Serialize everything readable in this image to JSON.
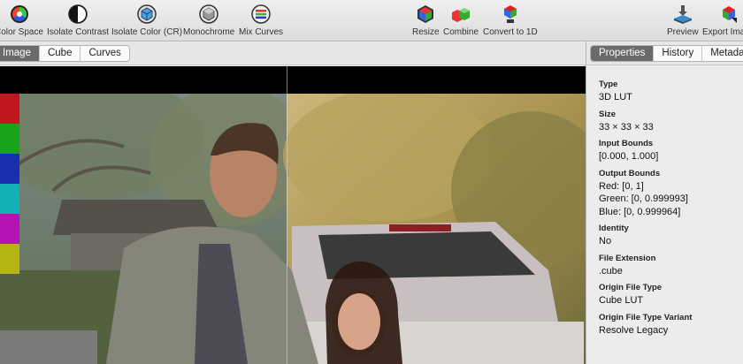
{
  "toolbar": {
    "left_tools": [
      {
        "label": "Color Space",
        "icon": "color-space-icon"
      },
      {
        "label": "Isolate Contrast",
        "icon": "isolate-contrast-icon"
      },
      {
        "label": "Isolate Color (CR)",
        "icon": "isolate-color-icon"
      },
      {
        "label": "Monochrome",
        "icon": "monochrome-icon"
      },
      {
        "label": "Mix Curves",
        "icon": "mix-curves-icon"
      }
    ],
    "center_tools": [
      {
        "label": "Resize",
        "icon": "resize-cube-icon"
      },
      {
        "label": "Combine",
        "icon": "combine-cubes-icon"
      },
      {
        "label": "Convert to 1D",
        "icon": "convert-1d-icon"
      }
    ],
    "right_tools": [
      {
        "label": "Preview",
        "icon": "preview-icon"
      },
      {
        "label": "Export Image",
        "icon": "export-image-icon"
      }
    ]
  },
  "view_tabs": [
    {
      "label": "Image",
      "active": true
    },
    {
      "label": "Cube",
      "active": false
    },
    {
      "label": "Curves",
      "active": false
    }
  ],
  "panel_tabs": [
    {
      "label": "Properties",
      "active": true
    },
    {
      "label": "History",
      "active": false
    },
    {
      "label": "Metadata",
      "active": false
    }
  ],
  "properties": {
    "type_label": "Type",
    "type_value": "3D LUT",
    "size_label": "Size",
    "size_value": "33 × 33 × 33",
    "input_bounds_label": "Input Bounds",
    "input_bounds_value": "[0.000, 1.000]",
    "output_bounds_label": "Output Bounds",
    "output_red": "Red: [0, 1]",
    "output_green": "Green: [0, 0.999993]",
    "output_blue": "Blue: [0, 0.999964]",
    "identity_label": "Identity",
    "identity_value": "No",
    "file_ext_label": "File Extension",
    "file_ext_value": ".cube",
    "origin_type_label": "Origin File Type",
    "origin_type_value": "Cube LUT",
    "origin_variant_label": "Origin File Type Variant",
    "origin_variant_value": "Resolve Legacy"
  },
  "swatch_colors": [
    "#c0161c",
    "#18a51c",
    "#1a2fb0",
    "#14b0b8",
    "#b414b4",
    "#b4b414"
  ],
  "accent_tab_color": "#6a6a6a"
}
